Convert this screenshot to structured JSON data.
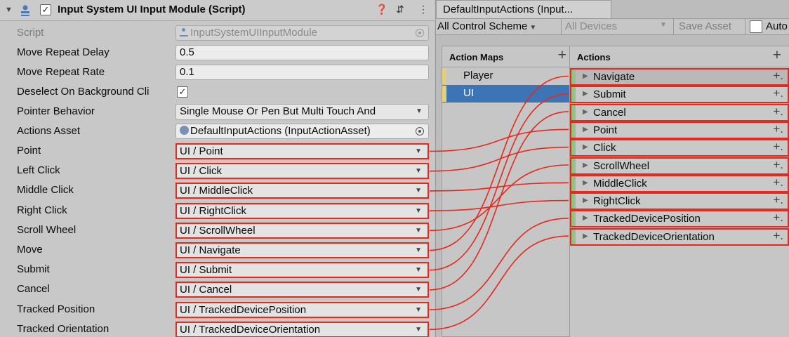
{
  "inspector": {
    "title": "Input System UI Input Module (Script)",
    "enabled_check": "✓",
    "header_icons": [
      "help-icon",
      "preset-icon",
      "menu-icon"
    ],
    "script": {
      "label": "Script",
      "value": "InputSystemUIInputModule"
    },
    "move_repeat_delay": {
      "label": "Move Repeat Delay",
      "value": "0.5"
    },
    "move_repeat_rate": {
      "label": "Move Repeat Rate",
      "value": "0.1"
    },
    "deselect": {
      "label": "Deselect On Background Cli",
      "check": "✓"
    },
    "pointer_behavior": {
      "label": "Pointer Behavior",
      "value": "Single Mouse Or Pen But Multi Touch And"
    },
    "actions_asset": {
      "label": "Actions Asset",
      "value": "DefaultInputActions (InputActionAsset)"
    },
    "bindings": [
      {
        "label": "Point",
        "value": "UI / Point"
      },
      {
        "label": "Left Click",
        "value": "UI / Click"
      },
      {
        "label": "Middle Click",
        "value": "UI / MiddleClick"
      },
      {
        "label": "Right Click",
        "value": "UI / RightClick"
      },
      {
        "label": "Scroll Wheel",
        "value": "UI / ScrollWheel"
      },
      {
        "label": "Move",
        "value": "UI / Navigate"
      },
      {
        "label": "Submit",
        "value": "UI / Submit"
      },
      {
        "label": "Cancel",
        "value": "UI / Cancel"
      },
      {
        "label": "Tracked Position",
        "value": "UI / TrackedDevicePosition"
      },
      {
        "label": "Tracked Orientation",
        "value": "UI / TrackedDeviceOrientation"
      }
    ]
  },
  "actions_window": {
    "tab_title": "DefaultInputActions (Input...",
    "toolbar": {
      "control_scheme": "All Control Scheme",
      "devices": "All Devices",
      "save_asset": "Save Asset",
      "auto_save": "Auto"
    },
    "maps_header": "Action Maps",
    "maps": [
      {
        "name": "Player",
        "selected": false
      },
      {
        "name": "UI",
        "selected": true
      }
    ],
    "actions_header": "Actions",
    "actions": [
      "Navigate",
      "Submit",
      "Cancel",
      "Point",
      "Click",
      "ScrollWheel",
      "MiddleClick",
      "RightClick",
      "TrackedDevicePosition",
      "TrackedDeviceOrientation"
    ]
  },
  "binding_links": [
    3,
    4,
    6,
    7,
    5,
    0,
    1,
    2,
    8,
    9
  ],
  "colors": {
    "highlight": "#e8271d",
    "selected_map": "#3d74b5",
    "map_bar": "#e3d07a",
    "action_bar": "#93c284"
  }
}
